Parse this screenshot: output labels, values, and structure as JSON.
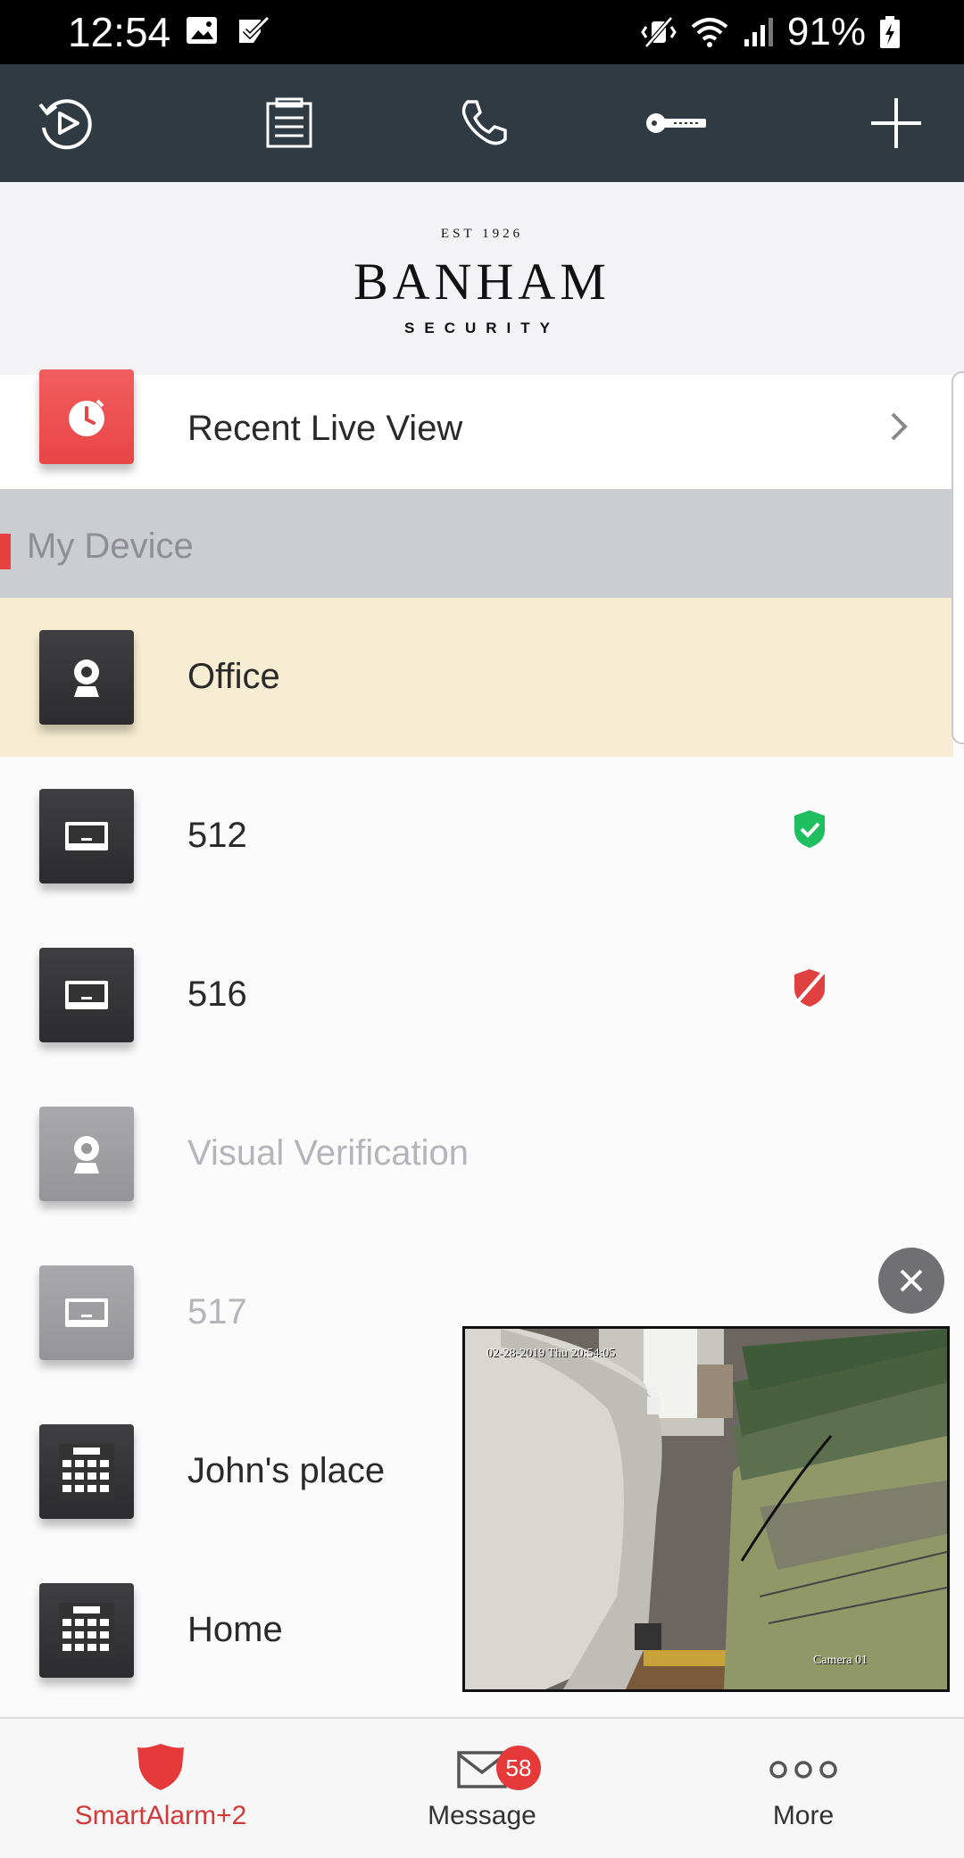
{
  "status_bar": {
    "time": "12:54",
    "battery": "91%"
  },
  "toolbar": {
    "buttons": [
      {
        "name": "playback",
        "icon": "replay-icon"
      },
      {
        "name": "logs",
        "icon": "clipboard-icon"
      },
      {
        "name": "call",
        "icon": "phone-icon"
      },
      {
        "name": "key",
        "icon": "key-icon"
      },
      {
        "name": "add",
        "icon": "plus-icon"
      }
    ]
  },
  "logo": {
    "est": "EST 1926",
    "name": "BANHAM",
    "sub": "SECURITY"
  },
  "recent": {
    "label": "Recent Live View"
  },
  "section": {
    "label": "My Device"
  },
  "devices": [
    {
      "label": "Office",
      "type": "camera",
      "state": "selected"
    },
    {
      "label": "512",
      "type": "panel",
      "shield": "armed-green"
    },
    {
      "label": "516",
      "type": "panel",
      "shield": "disarmed-red"
    },
    {
      "label": "Visual Verification",
      "type": "camera",
      "state": "offline"
    },
    {
      "label": "517",
      "type": "panel",
      "state": "offline"
    },
    {
      "label": "John's place",
      "type": "keypad"
    },
    {
      "label": "Home",
      "type": "keypad"
    }
  ],
  "video": {
    "timestamp": "02-28-2019 Thu 20:54:05",
    "camera": "Camera 01"
  },
  "bottom_nav": {
    "items": [
      {
        "label": "SmartAlarm+2",
        "icon": "shield-icon",
        "active": true
      },
      {
        "label": "Message",
        "icon": "envelope-icon",
        "badge": "58"
      },
      {
        "label": "More",
        "icon": "more-icon"
      }
    ]
  },
  "colors": {
    "accent": "#e5393a",
    "toolbar": "#2f3a43",
    "selected_row": "#f7edd2",
    "shield_green": "#1fbf60",
    "shield_red": "#e04040"
  }
}
